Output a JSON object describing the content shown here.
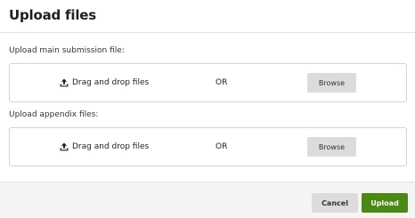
{
  "dialog": {
    "title": "Upload files"
  },
  "main_submission": {
    "label": "Upload main submission file:",
    "drag_text": "Drag and drop files",
    "or_text": "OR",
    "browse_label": "Browse",
    "icon": "upload-icon"
  },
  "appendix": {
    "label": "Upload appendix files:",
    "drag_text": "Drag and drop files",
    "or_text": "OR",
    "browse_label": "Browse",
    "icon": "upload-icon"
  },
  "footer": {
    "cancel_label": "Cancel",
    "upload_label": "Upload"
  },
  "colors": {
    "upload_button": "#4a8a10",
    "secondary_button": "#dcdcdc",
    "footer_bg": "#f5f5f5"
  }
}
